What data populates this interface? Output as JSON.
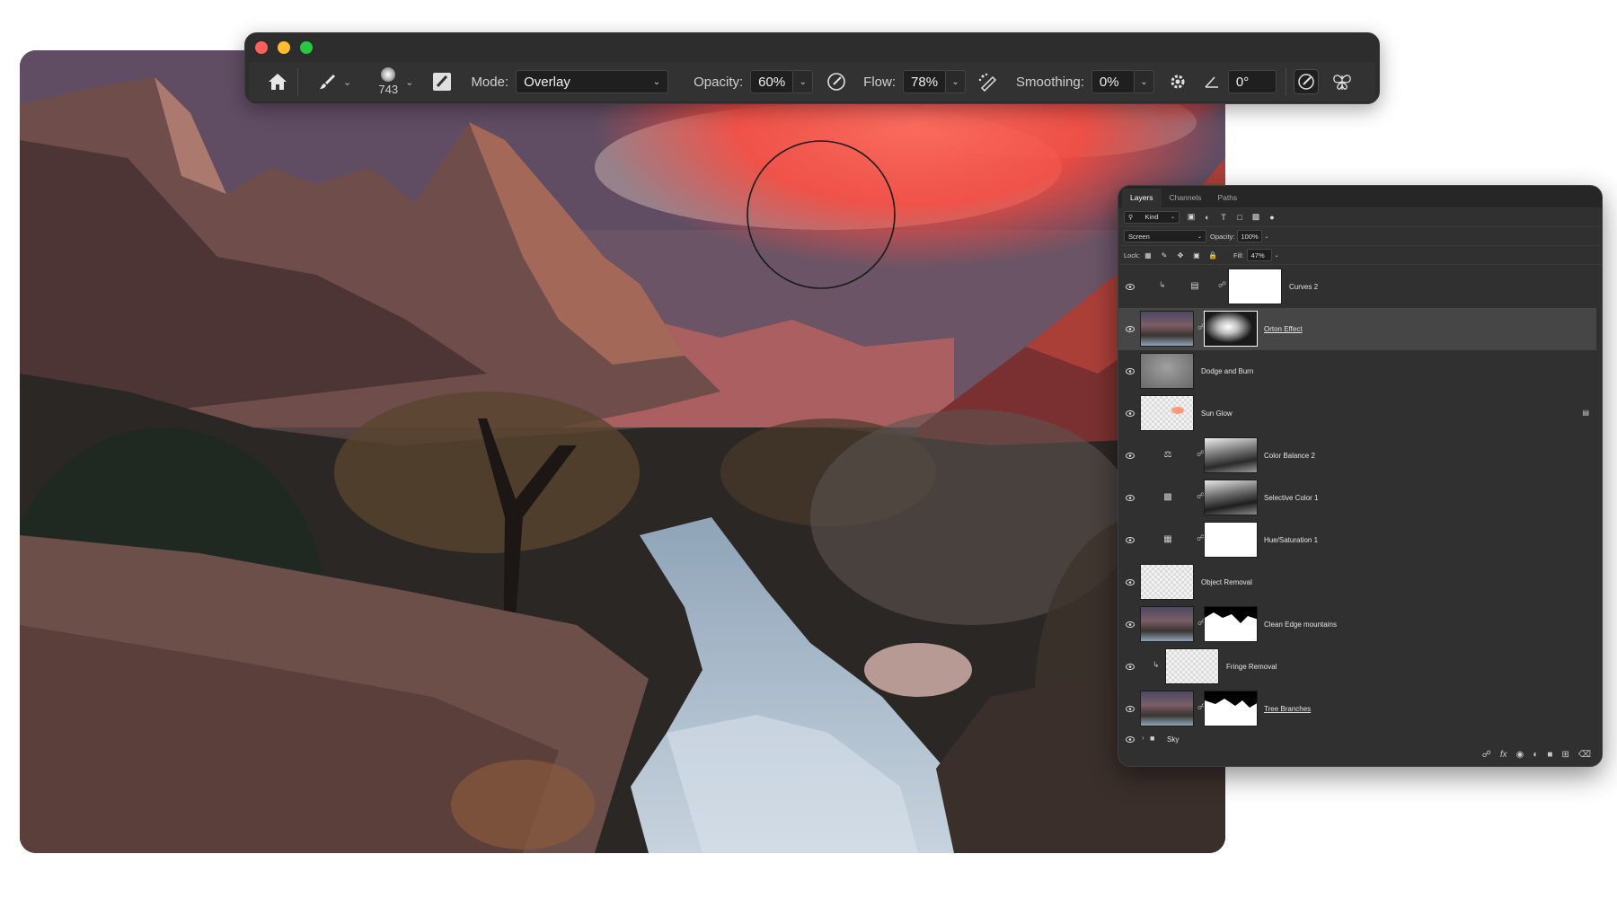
{
  "toolbar": {
    "brush_size": "743",
    "mode_label": "Mode:",
    "mode_value": "Overlay",
    "opacity_label": "Opacity:",
    "opacity_value": "60%",
    "flow_label": "Flow:",
    "flow_value": "78%",
    "smoothing_label": "Smoothing:",
    "smoothing_value": "0%",
    "angle_value": "0°"
  },
  "layers_panel": {
    "tabs": [
      "Layers",
      "Channels",
      "Paths"
    ],
    "filter_kind": "Kind",
    "blend_mode": "Screen",
    "opacity_label": "Opacity:",
    "opacity_value": "100%",
    "lock_label": "Lock:",
    "fill_label": "Fill:",
    "fill_value": "47%",
    "layers": [
      {
        "name": "Curves 2"
      },
      {
        "name": "Orton Effect"
      },
      {
        "name": "Dodge and Burn"
      },
      {
        "name": "Sun Glow"
      },
      {
        "name": "Color Balance 2"
      },
      {
        "name": "Selective Color 1"
      },
      {
        "name": "Hue/Saturation 1"
      },
      {
        "name": "Object Removal"
      },
      {
        "name": "Clean Edge mountains"
      },
      {
        "name": "Fringe Removal"
      },
      {
        "name": "Tree Branches"
      },
      {
        "name": "Sky"
      }
    ]
  },
  "colors": {
    "overlay_red": "#ff4a3d",
    "panel_bg": "#303030",
    "toolbar_bg": "#2d2d2d"
  }
}
